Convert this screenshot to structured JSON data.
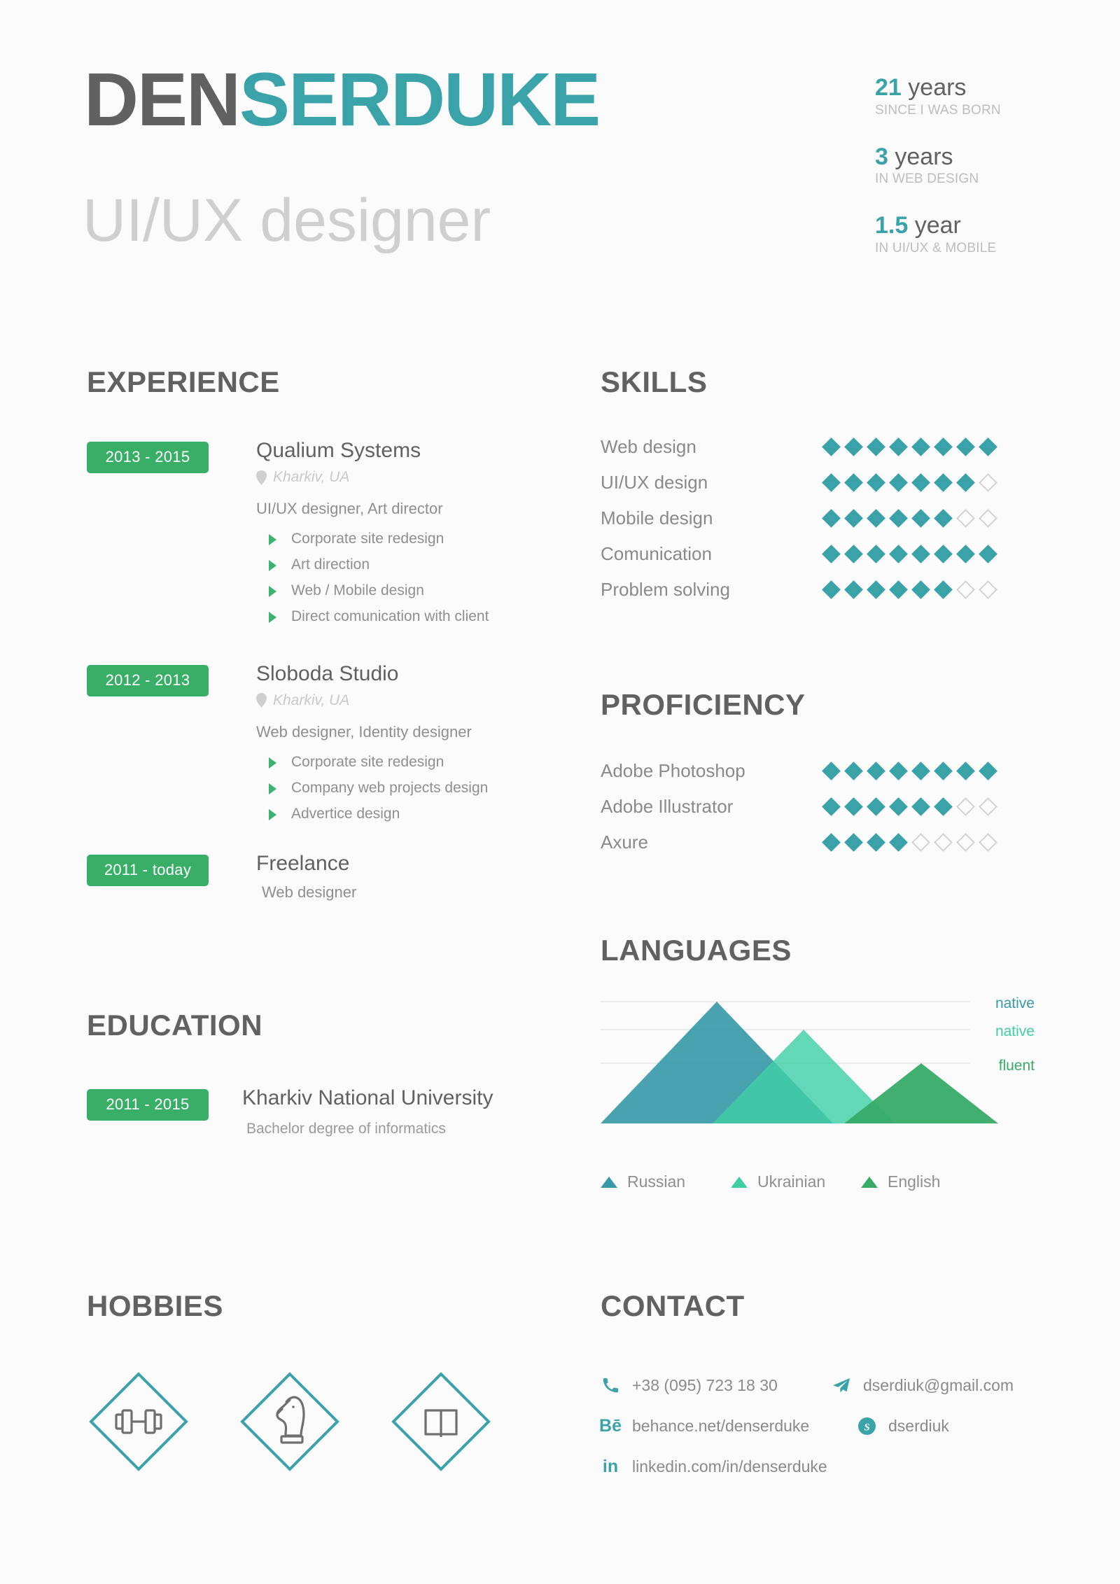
{
  "header": {
    "name_first": "DEN",
    "name_last": "SERDUKE",
    "role": "UI/UX designer",
    "stats": [
      {
        "number": "21",
        "unit": "years",
        "caption": "SINCE I WAS BORN"
      },
      {
        "number": "3",
        "unit": "years",
        "caption": "IN WEB DESIGN"
      },
      {
        "number": "1.5",
        "unit": "year",
        "caption": "IN UI/UX & MOBILE"
      }
    ]
  },
  "experience": {
    "title": "EXPERIENCE",
    "jobs": [
      {
        "dates": "2013 - 2015",
        "company": "Qualium Systems",
        "location": "Kharkiv, UA",
        "role": "UI/UX designer, Art director",
        "bullets": [
          "Corporate site redesign",
          "Art direction",
          "Web / Mobile design",
          "Direct comunication with client"
        ]
      },
      {
        "dates": "2012 - 2013",
        "company": "Sloboda Studio",
        "location": "Kharkiv, UA",
        "role": "Web designer, Identity designer",
        "bullets": [
          "Corporate site redesign",
          "Company web projects design",
          "Advertice design"
        ]
      },
      {
        "dates": "2011 - today",
        "company": "Freelance",
        "location": "",
        "role": "Web designer",
        "bullets": []
      }
    ]
  },
  "education": {
    "title": "EDUCATION",
    "dates": "2011 - 2015",
    "school": "Kharkiv National University",
    "degree": "Bachelor degree of informatics"
  },
  "skills": {
    "title": "SKILLS",
    "max": 8,
    "items": [
      {
        "label": "Web design",
        "value": 8
      },
      {
        "label": "UI/UX design",
        "value": 7
      },
      {
        "label": "Mobile design",
        "value": 6
      },
      {
        "label": "Comunication",
        "value": 8
      },
      {
        "label": "Problem solving",
        "value": 6
      }
    ]
  },
  "proficiency": {
    "title": "PROFICIENCY",
    "max": 8,
    "items": [
      {
        "label": "Adobe Photoshop",
        "value": 8
      },
      {
        "label": "Adobe Illustrator",
        "value": 6
      },
      {
        "label": "Axure",
        "value": 4
      }
    ]
  },
  "languages": {
    "title": "LANGUAGES",
    "scale_labels": [
      "native",
      "native",
      "fluent"
    ],
    "legend": [
      {
        "label": "Russian",
        "color": "#389aa8"
      },
      {
        "label": "Ukrainian",
        "color": "#3fcfa6"
      },
      {
        "label": "English",
        "color": "#37ab68"
      }
    ]
  },
  "chart_data": {
    "type": "area",
    "title": "LANGUAGES",
    "categories": [
      "Russian",
      "Ukrainian",
      "English"
    ],
    "values": [
      3,
      2,
      1
    ],
    "value_labels": [
      "native",
      "native",
      "fluent"
    ],
    "ylim": [
      0,
      3
    ],
    "ytick_labels": [
      "fluent",
      "native",
      "native"
    ],
    "grid": true,
    "legend_position": "bottom",
    "series": [
      {
        "name": "Russian",
        "peak_level": 3,
        "color": "#389aa8",
        "peak_x_pct": 33
      },
      {
        "name": "Ukrainian",
        "peak_level": 2,
        "color": "#3fcfa6",
        "peak_x_pct": 58
      },
      {
        "name": "English",
        "peak_level": 1,
        "color": "#37ab68",
        "peak_x_pct": 83
      }
    ],
    "xlabel": "",
    "ylabel": ""
  },
  "hobbies": {
    "title": "HOBBIES",
    "items": [
      {
        "icon": "dumbbell-icon",
        "name": "gym"
      },
      {
        "icon": "chess-knight-icon",
        "name": "chess"
      },
      {
        "icon": "open-book-icon",
        "name": "reading"
      }
    ]
  },
  "contact": {
    "title": "CONTACT",
    "phone": "+38 (095) 723 18 30",
    "email": "dserdiuk@gmail.com",
    "behance": "behance.net/denserduke",
    "behance_mark": "Bē",
    "skype": "dserdiuk",
    "linkedin": "linkedin.com/in/denserduke",
    "linkedin_mark": "in"
  },
  "colors": {
    "teal": "#3aa3a9",
    "green": "#38ae67",
    "grey_text": "#8a8a8a",
    "dark_text": "#616161",
    "background": "#fbfbfb"
  }
}
